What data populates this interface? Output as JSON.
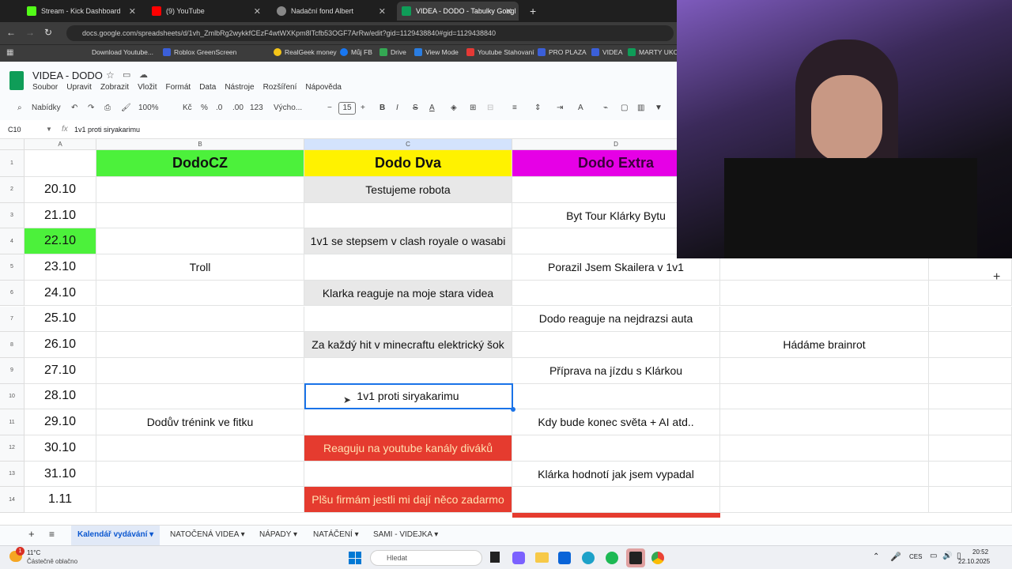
{
  "browser": {
    "tabs": [
      {
        "title": "Stream - Kick Dashboard",
        "color": "#53fc18"
      },
      {
        "title": "(9) YouTube",
        "color": "#ff0000"
      },
      {
        "title": "Nadační fond Albert",
        "color": "#888888"
      },
      {
        "title": "VIDEA - DODO - Tabulky Googl",
        "color": "#0f9d58"
      }
    ],
    "url": "docs.google.com/spreadsheets/d/1vh_ZmlbRg2wykkfCEzF4wtWXKpm8lTcfb53OGF7ArRw/edit?gid=1129438840#gid=1129438840",
    "bookmarks": [
      "Download Youtube...",
      "Roblox GreenScreen",
      "RealGeek money",
      "Můj FB",
      "Drive",
      "View Mode",
      "Youtube Stahovaní",
      "PRO PLAZA",
      "VIDEA",
      "MARTY UKOL"
    ]
  },
  "sheets": {
    "doc_title": "VIDEA - DODO",
    "menu": [
      "Soubor",
      "Upravit",
      "Zobrazit",
      "Vložit",
      "Formát",
      "Data",
      "Nástroje",
      "Rozšíření",
      "Nápověda"
    ],
    "toolbar": {
      "search": "Nabídky",
      "zoom": "100%",
      "currency": "Kč",
      "percent": "%",
      "dec_less": ".0",
      "dec_more": ".00",
      "numfmt": "123",
      "font": "Výcho...",
      "font_size": "15"
    },
    "name_box": "C10",
    "formula": "1v1 proti siryakarimu",
    "columns": [
      "A",
      "B",
      "C",
      "D"
    ],
    "header_row": {
      "b": "DodoCZ",
      "c": "Dodo Dva",
      "d": "Dodo Extra"
    },
    "rows": [
      {
        "n": "2",
        "a": "20.10",
        "b": "",
        "c": "Testujeme robota",
        "d": "",
        "e": ""
      },
      {
        "n": "3",
        "a": "21.10",
        "b": "",
        "c": "",
        "d": "Byt Tour Klárky Bytu",
        "e": ""
      },
      {
        "n": "4",
        "a": "22.10",
        "b": "",
        "c": "1v1 se stepsem v clash royale o wasabi",
        "d": "",
        "e": ""
      },
      {
        "n": "5",
        "a": "23.10",
        "b": "Troll",
        "c": "",
        "d": "Porazil Jsem Skailera v 1v1",
        "e": ""
      },
      {
        "n": "6",
        "a": "24.10",
        "b": "",
        "c": "Klarka reaguje na moje stara videa",
        "d": "",
        "e": ""
      },
      {
        "n": "7",
        "a": "25.10",
        "b": "",
        "c": "",
        "d": "Dodo reaguje na nejdrazsi auta",
        "e": ""
      },
      {
        "n": "8",
        "a": "26.10",
        "b": "",
        "c": "Za každý hit v minecraftu elektrický šok",
        "d": "",
        "e": "Hádáme brainrot"
      },
      {
        "n": "9",
        "a": "27.10",
        "b": "",
        "c": "",
        "d": "Příprava na jízdu s Klárkou",
        "e": ""
      },
      {
        "n": "10",
        "a": "28.10",
        "b": "",
        "c": "1v1 proti siryakarimu",
        "d": "",
        "e": ""
      },
      {
        "n": "11",
        "a": "29.10",
        "b": "Dodův trénink ve fitku",
        "c": "",
        "d": "Kdy bude konec světa + AI atd..",
        "e": ""
      },
      {
        "n": "12",
        "a": "30.10",
        "b": "",
        "c": "Reaguju na youtube kanály diváků",
        "d": "",
        "e": ""
      },
      {
        "n": "13",
        "a": "31.10",
        "b": "",
        "c": "",
        "d": "Klárka hodnotí jak jsem vypadal",
        "e": ""
      },
      {
        "n": "14",
        "a": "1.11",
        "b": "",
        "c": "Plšu firmám jestli mi dají něco zadarmo",
        "d": "",
        "e": ""
      }
    ],
    "sheet_tabs": [
      "Kalendář vydávání",
      "NATOČENÁ VIDEA",
      "NÁPADY",
      "NATÁČENÍ",
      "SAMI - VIDEJKA"
    ]
  },
  "taskbar": {
    "temp": "11°C",
    "weather": "Částečně oblačno",
    "search": "Hledat",
    "lang": "CES",
    "time": "20:52",
    "date": "22.10.2025",
    "notif": "1"
  },
  "colors": {
    "green": "#4cf13b",
    "yellow": "#fff200",
    "magenta": "#e600e6",
    "red": "#e53b2f",
    "selection": "#1a73e8"
  }
}
